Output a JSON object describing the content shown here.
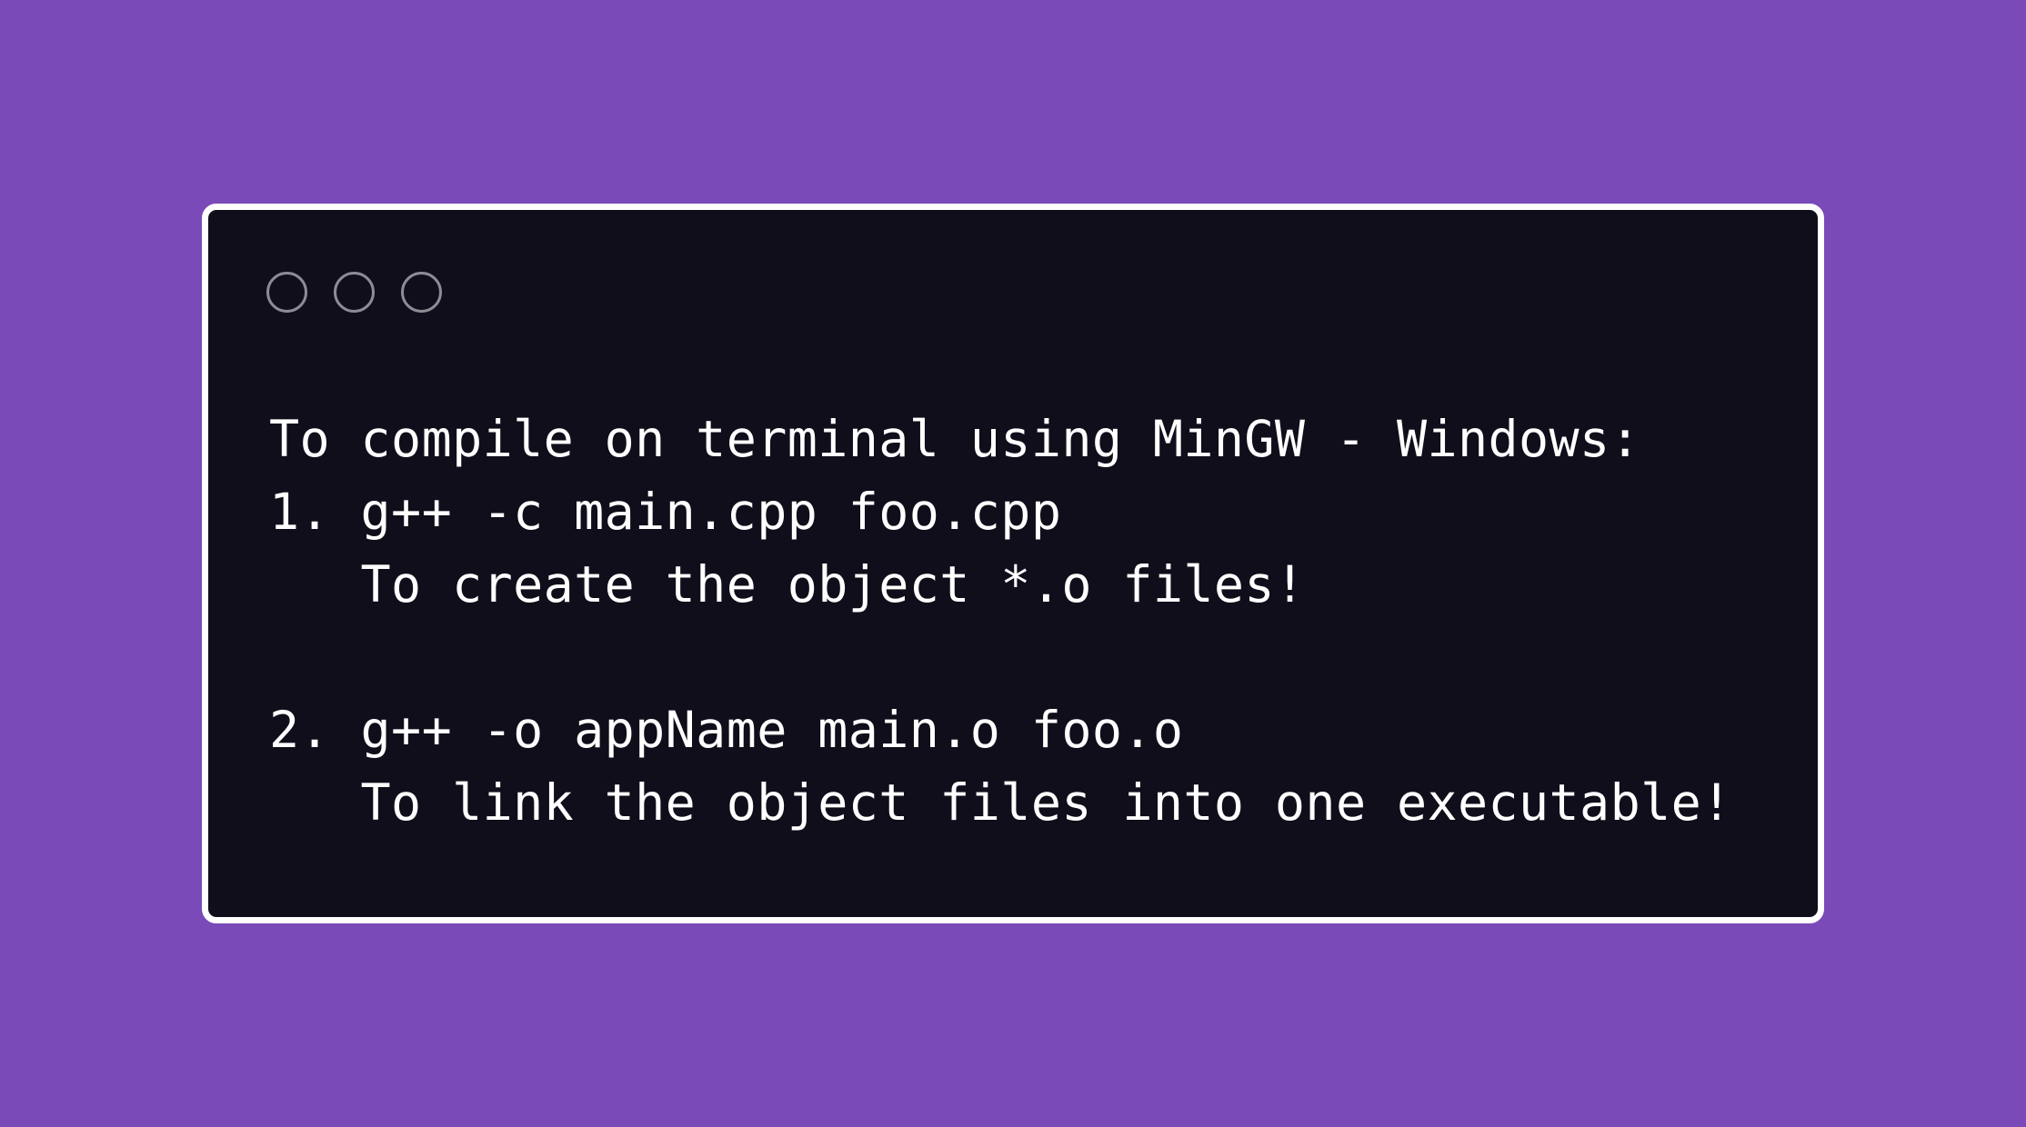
{
  "window": {
    "controls": [
      "circle-control",
      "circle-control",
      "circle-control"
    ],
    "lines": [
      "To compile on terminal using MinGW - Windows:",
      "1. g++ -c main.cpp foo.cpp",
      "   To create the object *.o files!",
      "",
      "2. g++ -o appName main.o foo.o",
      "   To link the object files into one executable!"
    ]
  },
  "colors": {
    "background": "#7a4ab8",
    "window": "#110e1b",
    "text": "#ffffff",
    "control_border": "#8f8b95"
  }
}
